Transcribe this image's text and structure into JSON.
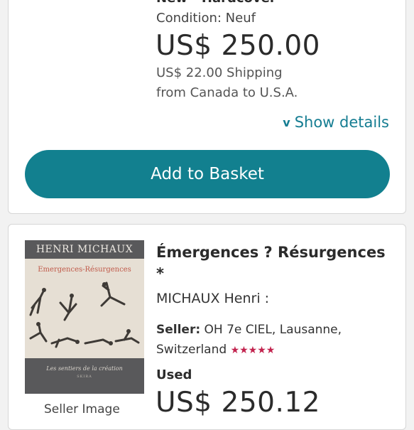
{
  "listing1": {
    "binding": "New - Hardcover",
    "condition": "Condition: Neuf",
    "price": "US$ 250.00",
    "shipping_line1": "US$ 22.00 Shipping",
    "shipping_line2": "from Canada to U.S.A.",
    "show_details": "Show details",
    "add_to_basket": "Add to Basket"
  },
  "listing2": {
    "title": "Émergences ? Résurgences *",
    "author": "MICHAUX Henri :",
    "seller_label": "Seller:",
    "seller_name": "OH 7e CIEL, Lausanne, Switzerland",
    "seller_stars": "★★★★★",
    "condition": "Used",
    "price": "US$ 250.12",
    "image_label": "Seller Image",
    "cover": {
      "author": "HENRI MICHAUX",
      "subtitle": "Emergences-Résurgences",
      "series": "Les sentiers de la création",
      "publisher": "SKIRA"
    }
  },
  "colors": {
    "accent": "#12808f",
    "link": "#157d92",
    "stars": "#c2234e",
    "background": "#f2f2f2",
    "card": "#ffffff"
  },
  "icons": {
    "show_details": "chevron-down-icon",
    "rating": "star-icon"
  }
}
